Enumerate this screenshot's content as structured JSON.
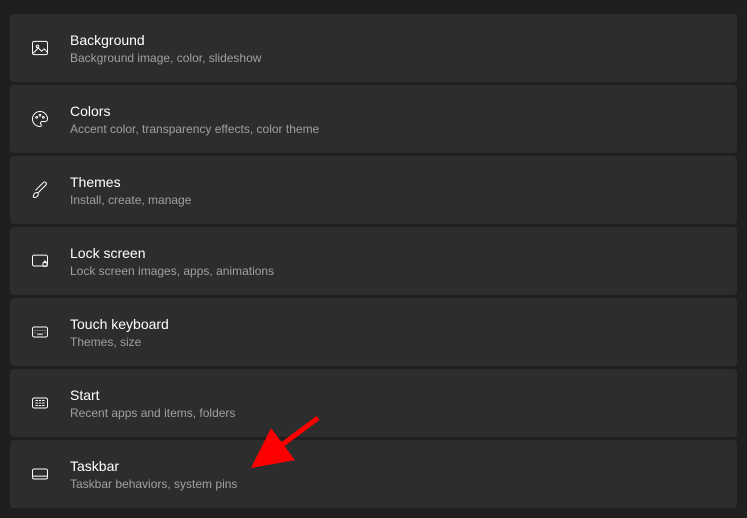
{
  "items": [
    {
      "id": "background",
      "title": "Background",
      "subtitle": "Background image, color, slideshow"
    },
    {
      "id": "colors",
      "title": "Colors",
      "subtitle": "Accent color, transparency effects, color theme"
    },
    {
      "id": "themes",
      "title": "Themes",
      "subtitle": "Install, create, manage"
    },
    {
      "id": "lock-screen",
      "title": "Lock screen",
      "subtitle": "Lock screen images, apps, animations"
    },
    {
      "id": "touch-keyboard",
      "title": "Touch keyboard",
      "subtitle": "Themes, size"
    },
    {
      "id": "start",
      "title": "Start",
      "subtitle": "Recent apps and items, folders"
    },
    {
      "id": "taskbar",
      "title": "Taskbar",
      "subtitle": "Taskbar behaviors, system pins"
    }
  ]
}
